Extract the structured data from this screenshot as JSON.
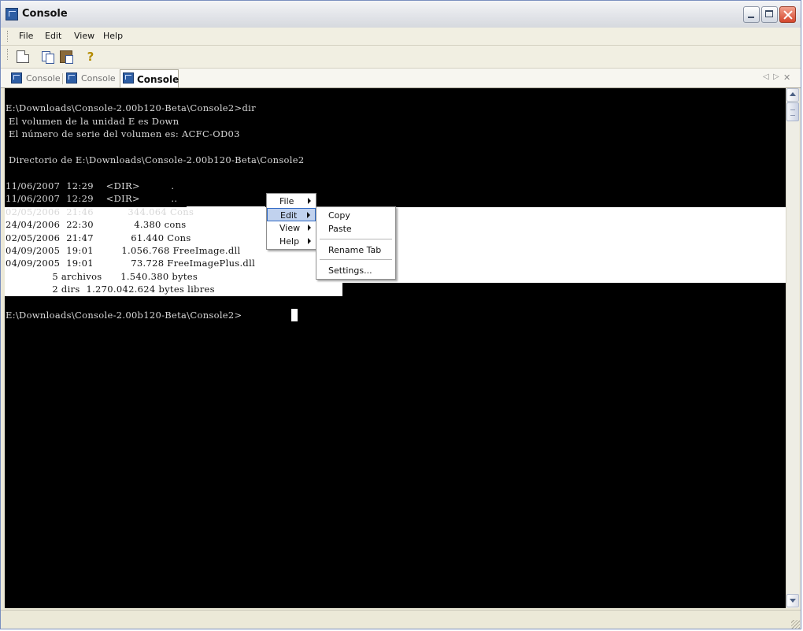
{
  "window": {
    "title": "Console"
  },
  "menubar": {
    "items": [
      "File",
      "Edit",
      "View",
      "Help"
    ]
  },
  "toolbar": {
    "buttons": [
      "new-tab-icon",
      "copy-icon",
      "paste-icon",
      "about-icon"
    ]
  },
  "tabs": [
    {
      "label": "Console"
    },
    {
      "label": "Console"
    },
    {
      "label": "Console"
    }
  ],
  "tab_controls": {
    "prev": "◁",
    "next": "▷",
    "close": "✕"
  },
  "console": {
    "lines": [
      "E:\\Downloads\\Console-2.00b120-Beta\\Console2>dir",
      " El volumen de la unidad E es Down",
      " El número de serie del volumen es: ACFC-OD03",
      "",
      " Directorio de E:\\Downloads\\Console-2.00b120-Beta\\Console2",
      "",
      "11/06/2007  12:29    <DIR>          .",
      "11/06/2007  12:29    <DIR>          ..",
      "02/05/2006  21:46           344.064 Cons",
      "24/04/2006  22:30             4.380 cons",
      "02/05/2006  21:47            61.440 Cons",
      "04/09/2005  19:01         1.056.768 FreeImage.dll",
      "04/09/2005  19:01            73.728 FreeImagePlus.dll",
      "               5 archivos      1.540.380 bytes",
      "               2 dirs  1.270.042.624 bytes libres",
      "",
      "E:\\Downloads\\Console-2.00b120-Beta\\Console2>"
    ]
  },
  "context_menu": {
    "items": [
      {
        "label": "File",
        "submenu": true
      },
      {
        "label": "Edit",
        "submenu": true,
        "highlighted": true
      },
      {
        "label": "View",
        "submenu": true
      },
      {
        "label": "Help",
        "submenu": true
      }
    ],
    "edit_submenu": [
      "Copy",
      "Paste",
      "Rename Tab",
      "Settings..."
    ]
  },
  "colors": {
    "console_bg": "#000000",
    "console_text": "#d8d8d8",
    "selection": "#ffffff",
    "menu_highlight": "#c1d2ee"
  }
}
